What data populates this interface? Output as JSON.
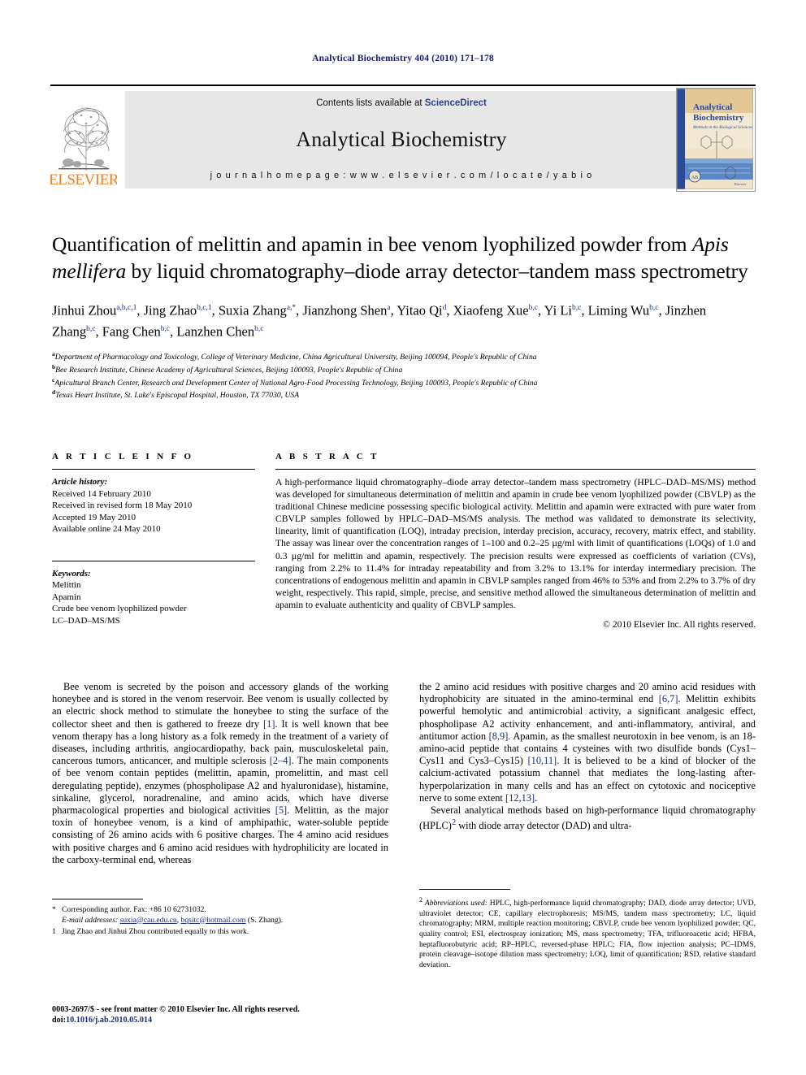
{
  "running_head": "Analytical Biochemistry 404 (2010) 171–178",
  "masthead": {
    "publisher_logo_text": "ELSEVIER",
    "contents_prefix": "Contents lists available at",
    "contents_link": "ScienceDirect",
    "journal_name": "Analytical Biochemistry",
    "homepage_label": "j o u r n a l   h o m e p a g e :   w w w . e l s e v i e r . c o m / l o c a t e / y a b i o",
    "cover": {
      "line1": "Analytical",
      "line2": "Biochemistry",
      "subtitle": "Methods in the Biological Sciences",
      "publisher": "Elsevier"
    }
  },
  "title": {
    "part1": "Quantification of melittin and apamin in bee venom lyophilized powder from ",
    "italic": "Apis mellifera",
    "part2": " by liquid chromatography–diode array detector–tandem mass spectrometry"
  },
  "authors": [
    {
      "name": "Jinhui Zhou",
      "sup": "a,b,c,1",
      "sep": ", "
    },
    {
      "name": "Jing Zhao",
      "sup": "b,c,1",
      "sep": ", "
    },
    {
      "name": "Suxia Zhang",
      "sup": "a,*",
      "sep": ", "
    },
    {
      "name": "Jianzhong Shen",
      "sup": "a",
      "sep": ", "
    },
    {
      "name": "Yitao Qi",
      "sup": "d",
      "sep": ", "
    },
    {
      "name": "Xiaofeng Xue",
      "sup": "b,c",
      "sep": ", "
    },
    {
      "name": "Yi Li",
      "sup": "b,c",
      "sep": ", "
    },
    {
      "name": "Liming Wu",
      "sup": "b,c",
      "sep": ", "
    },
    {
      "name": "Jinzhen Zhang",
      "sup": "b,c",
      "sep": ", "
    },
    {
      "name": "Fang Chen",
      "sup": "b,c",
      "sep": ", "
    },
    {
      "name": "Lanzhen Chen",
      "sup": "b,c",
      "sep": ""
    }
  ],
  "affiliations": [
    {
      "marker": "a",
      "text": "Department of Pharmacology and Toxicology, College of Veterinary Medicine, China Agricultural University, Beijing 100094, People's Republic of China"
    },
    {
      "marker": "b",
      "text": "Bee Research Institute, Chinese Academy of Agricultural Sciences, Beijing 100093, People's Republic of China"
    },
    {
      "marker": "c",
      "text": "Apicultural Branch Center, Research and Development Center of National Agro-Food Processing Technology, Beijing 100093, People's Republic of China"
    },
    {
      "marker": "d",
      "text": "Texas Heart Institute, St. Luke's Episcopal Hospital, Houston, TX 77030, USA"
    }
  ],
  "article_info": {
    "heading": "A R T I C L E   I N F O",
    "history_label": "Article history:",
    "history": [
      "Received 14 February 2010",
      "Received in revised form 18 May 2010",
      "Accepted 19 May 2010",
      "Available online 24 May 2010"
    ],
    "keywords_label": "Keywords:",
    "keywords": [
      "Melittin",
      "Apamin",
      "Crude bee venom lyophilized powder",
      "LC–DAD–MS/MS"
    ]
  },
  "abstract": {
    "heading": "A B S T R A C T",
    "text": "A high-performance liquid chromatography–diode array detector–tandem mass spectrometry (HPLC–DAD–MS/MS) method was developed for simultaneous determination of melittin and apamin in crude bee venom lyophilized powder (CBVLP) as the traditional Chinese medicine possessing specific biological activity. Melittin and apamin were extracted with pure water from CBVLP samples followed by HPLC–DAD–MS/MS analysis. The method was validated to demonstrate its selectivity, linearity, limit of quantification (LOQ), intraday precision, interday precision, accuracy, recovery, matrix effect, and stability. The assay was linear over the concentration ranges of 1–100 and 0.2–25 µg/ml with limit of quantifications (LOQs) of 1.0 and 0.3 µg/ml for melittin and apamin, respectively. The precision results were expressed as coefficients of variation (CVs), ranging from 2.2% to 11.4% for intraday repeatability and from 3.2% to 13.1% for interday intermediary precision. The concentrations of endogenous melittin and apamin in CBVLP samples ranged from 46% to 53% and from 2.2% to 3.7% of dry weight, respectively. This rapid, simple, precise, and sensitive method allowed the simultaneous determination of melittin and apamin to evaluate authenticity and quality of CBVLP samples.",
    "copyright": "© 2010 Elsevier Inc. All rights reserved."
  },
  "body": {
    "left_paragraphs": [
      {
        "segments": [
          {
            "t": "Bee venom is secreted by the poison and accessory glands of the working honeybee and is stored in the venom reservoir. Bee venom is usually collected by an electric shock method to stimulate the honeybee to sting the surface of the collector sheet and then is gathered to freeze dry "
          },
          {
            "t": "[1]",
            "ref": true
          },
          {
            "t": ". It is well known that bee venom therapy has a long history as a folk remedy in the treatment of a variety of diseases, including arthritis, angiocardiopathy, back pain, musculoskeletal pain, cancerous tumors, anticancer, and multiple sclerosis "
          },
          {
            "t": "[2–4]",
            "ref": true
          },
          {
            "t": ". The main components of bee venom contain peptides (melittin, apamin, promelittin, and mast cell deregulating peptide), enzymes (phospholipase A2 and hyaluronidase), histamine, sinkaline, glycerol, noradrenaline, and amino acids, which have diverse pharmacological properties and biological activities "
          },
          {
            "t": "[5]",
            "ref": true
          },
          {
            "t": ". Melittin, as the major toxin of honeybee venom, is a kind of amphipathic, water-soluble peptide consisting of 26 amino acids with 6 positive charges. The 4 amino acid residues with positive charges and 6 amino acid residues with hydrophilicity are located in the carboxy-terminal end, whereas"
          }
        ]
      }
    ],
    "right_paragraphs": [
      {
        "indent": false,
        "segments": [
          {
            "t": "the 2 amino acid residues with positive charges and 20 amino acid residues with hydrophobicity are situated in the amino-terminal end "
          },
          {
            "t": "[6,7]",
            "ref": true
          },
          {
            "t": ". Melittin exhibits powerful hemolytic and antimicrobial activity, a significant analgesic effect, phospholipase A2 activity enhancement, and anti-inflammatory, antiviral, and antitumor action "
          },
          {
            "t": "[8,9]",
            "ref": true
          },
          {
            "t": ". Apamin, as the smallest neurotoxin in bee venom, is an 18-amino-acid peptide that contains 4 cysteines with two disulfide bonds (Cys1–Cys11 and Cys3–Cys15) "
          },
          {
            "t": "[10,11]",
            "ref": true
          },
          {
            "t": ". It is believed to be a kind of blocker of the calcium-activated potassium channel that mediates the long-lasting after-hyperpolarization in many cells and has an effect on cytotoxic and nociceptive nerve to some extent "
          },
          {
            "t": "[12,13]",
            "ref": true
          },
          {
            "t": "."
          }
        ]
      },
      {
        "indent": true,
        "segments": [
          {
            "t": "Several analytical methods based on high-performance liquid chromatography (HPLC)"
          },
          {
            "t": "2",
            "sup": true
          },
          {
            "t": " with diode array detector (DAD) and ultra-"
          }
        ]
      }
    ]
  },
  "footnotes": {
    "corresponding": {
      "marker": "*",
      "text": "Corresponding author. Fax: +86 10 62731032."
    },
    "email": {
      "label": "E-mail addresses:",
      "address1": "suxia@cau.edu.cn",
      "address2": "bqsitc@hotmail.com",
      "attribution": "(S. Zhang)."
    },
    "equal_contribution": {
      "marker": "1",
      "text": "Jing Zhao and Jinhui Zhou contributed equally to this work."
    },
    "abbreviations": {
      "marker": "2",
      "label": "Abbreviations used:",
      "text": " HPLC, high-performance liquid chromatography; DAD, diode array detector; UVD, ultraviolet detector; CE, capillary electrophoresis; MS/MS, tandem mass spectrometry; LC, liquid chromatography; MRM, multiple reaction monitoring; CBVLP, crude bee venom lyophilized powder; QC, quality control; ESI, electrospray ionization; MS, mass spectrometry; TFA, trifluoroacetic acid; HFBA, heptafluorobutyric acid; RP–HPLC, reversed-phase HPLC; FIA, flow injection analysis; PC–IDMS, protein cleavage–isotope dilution mass spectrometry; LOQ, limit of quantification; RSD, relative standard deviation."
    }
  },
  "footer": {
    "issn_line": "0003-2697/$ - see front matter © 2010 Elsevier Inc. All rights reserved.",
    "doi_prefix": "doi:",
    "doi": "10.1016/j.ab.2010.05.014"
  },
  "colors": {
    "link_blue": "#1a2a7a",
    "banner_gray": "#e7e7e7",
    "elsevier_orange": "#ef7f20"
  }
}
